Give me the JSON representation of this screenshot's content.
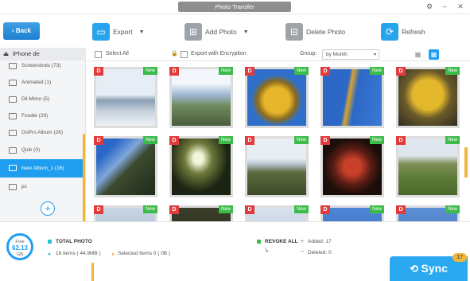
{
  "window": {
    "title": "Photo Transfer"
  },
  "toolbar": {
    "back_label": "Back",
    "export_label": "Export",
    "add_photo_label": "Add Photo",
    "delete_photo_label": "Delete Photo",
    "refresh_label": "Refresh"
  },
  "sidebar": {
    "device_name": "iPhone de",
    "items": [
      {
        "label": "Screenshots (73)"
      },
      {
        "label": "Animated (1)"
      },
      {
        "label": "Dil Mimo (5)"
      },
      {
        "label": "Foodie (29)"
      },
      {
        "label": "GoPro Album (26)"
      },
      {
        "label": "Quik (0)"
      },
      {
        "label": "New Album_1 (16)"
      },
      {
        "label": "pc"
      }
    ],
    "add_symbol": "+"
  },
  "filters": {
    "select_all_label": "Select All",
    "export_encryption_label": "Export with Encryption",
    "group_label": "Group:",
    "group_value": "by Month"
  },
  "photos": {
    "badge_d": "D",
    "badge_new": "New"
  },
  "footer": {
    "storage_label": "Free",
    "storage_value": "62.13",
    "storage_unit": "GB",
    "total_photo_label": "TOTAL PHOTO",
    "items_text": "16 items ( 44.9MB )",
    "selected_text": "Selected Items 0 ( 0B )",
    "revoke_all_label": "REVOKE ALL",
    "added_text": "Added: 17",
    "deleted_text": "Deleted: 0",
    "sync_label": "Sync",
    "sync_count": "17"
  },
  "colors": {
    "accent": "#1f9ef0",
    "new_badge": "#3dbb4a",
    "d_badge": "#e23b3b",
    "highlight": "#f3b43a"
  }
}
